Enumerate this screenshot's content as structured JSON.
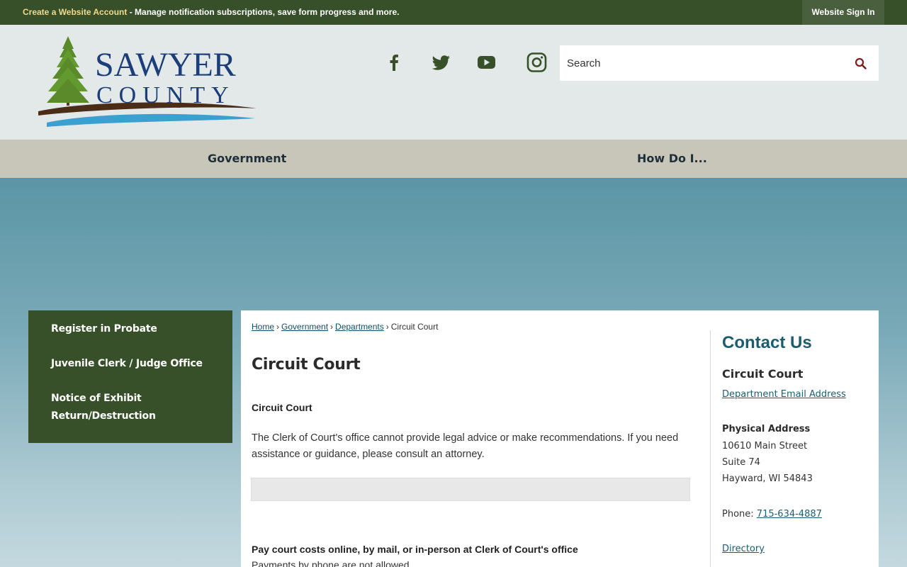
{
  "topbar": {
    "create_account_link": "Create a Website Account",
    "create_account_desc": " - Manage notification subscriptions, save form progress and more.",
    "sign_in": "Website Sign In"
  },
  "logo": {
    "line1": "SAWYER",
    "line2": "COUNTY"
  },
  "social": [
    "facebook-icon",
    "twitter-icon",
    "youtube-icon",
    "instagram-icon"
  ],
  "search": {
    "placeholder": "Search"
  },
  "nav": {
    "items": [
      "Government",
      "How Do I..."
    ]
  },
  "sidebar": {
    "items": [
      "Register in Probate",
      "Juvenile Clerk / Judge Office",
      "Notice of Exhibit Return/Destruction"
    ]
  },
  "breadcrumb": {
    "items": [
      "Home",
      "Government",
      "Departments"
    ],
    "current": "Circuit Court",
    "separator": "›"
  },
  "main": {
    "title": "Circuit Court",
    "subheading": "Circuit Court",
    "paragraph": "The Clerk of Court's office cannot provide legal advice or make recommendations.  If you need assistance or guidance, please consult an attorney.",
    "pay_heading": "Pay court costs online, by mail, or in-person at Clerk of Court's office",
    "pay_sub": "Payments by phone are not allowed."
  },
  "contact": {
    "title": "Contact Us",
    "department": "Circuit Court",
    "email_link": "Department Email Address",
    "address_label": "Physical Address",
    "address_line1": "10610 Main Street",
    "address_line2": "Suite 74",
    "address_line3": "Hayward, WI 54843",
    "phone_label": "Phone: ",
    "phone": "715-634-4887",
    "directory_link": "Directory"
  },
  "colors": {
    "brand_green": "#375029",
    "accent_yellow": "#f3d98a",
    "nav_bg": "#c7c6b9",
    "teal": "#1c5d6d"
  }
}
